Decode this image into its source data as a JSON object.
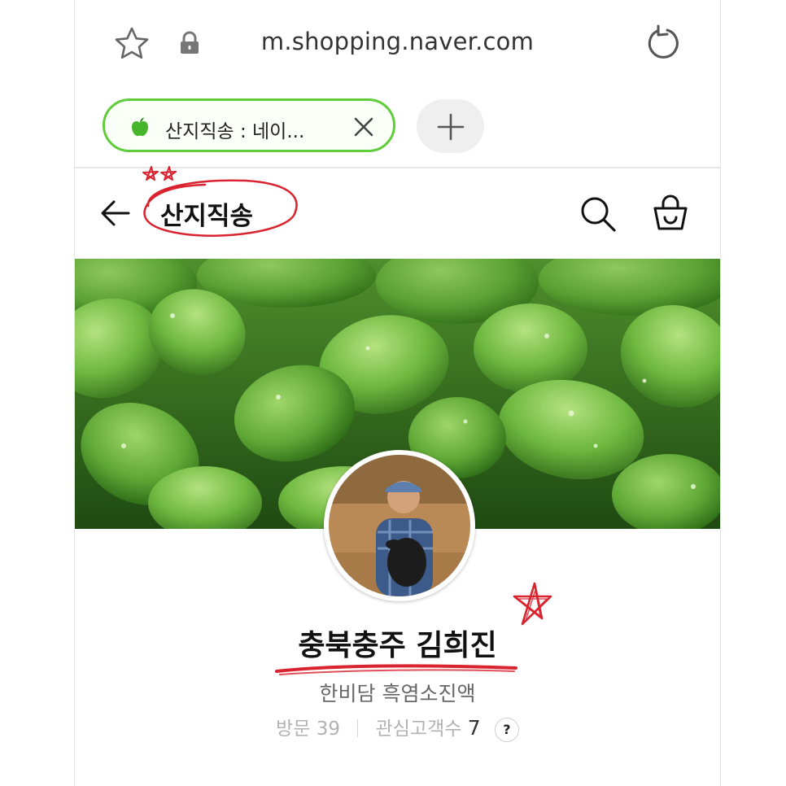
{
  "browser": {
    "url": "m.shopping.naver.com",
    "tab": {
      "title": "산지직송 : 네이..."
    },
    "new_tab_icon": "plus-icon"
  },
  "header": {
    "title": "산지직송",
    "back_icon": "arrow-left-icon",
    "search_icon": "search-icon",
    "cart_icon": "shopping-bag-icon"
  },
  "profile": {
    "name": "충북충주 김희진",
    "description": "한비담 흑염소진액",
    "visits_label": "방문",
    "visits_count": "39",
    "followers_label": "관심고객수",
    "followers_count": "7",
    "help_label": "?"
  },
  "colors": {
    "tab_border": "#5fcc3c",
    "annotation_red": "#d9232f",
    "banner_green": "#2f6a1f"
  }
}
